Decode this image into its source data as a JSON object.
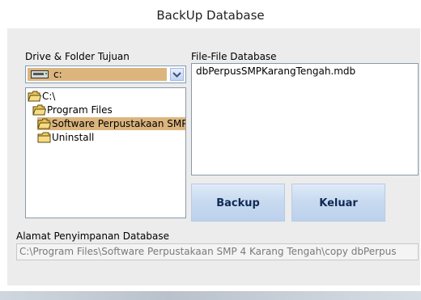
{
  "window": {
    "title": "BackUp Database"
  },
  "drive_section": {
    "label": "Drive & Folder Tujuan",
    "drive_value": "c:",
    "folders": [
      {
        "name": "C:\\",
        "icon": "open-folder-icon",
        "selected": false,
        "indent": 0
      },
      {
        "name": "Program Files",
        "icon": "open-folder-icon",
        "selected": false,
        "indent": 1
      },
      {
        "name": "Software Perpustakaan SMP",
        "icon": "open-folder-icon",
        "selected": true,
        "indent": 2
      },
      {
        "name": "Uninstall",
        "icon": "folder-icon",
        "selected": false,
        "indent": 2
      }
    ]
  },
  "files_section": {
    "label": "File-File Database",
    "files": [
      "dbPerpusSMPKarangTengah.mdb"
    ]
  },
  "buttons": {
    "backup": "Backup",
    "keluar": "Keluar"
  },
  "path_section": {
    "label": "Alamat Penyimpanan Database",
    "value": "C:\\Program Files\\Software Perpustakaan SMP 4 Karang Tengah\\copy dbPerpus"
  },
  "colors": {
    "selection": "#dcb57e",
    "button_text": "#102a55"
  }
}
